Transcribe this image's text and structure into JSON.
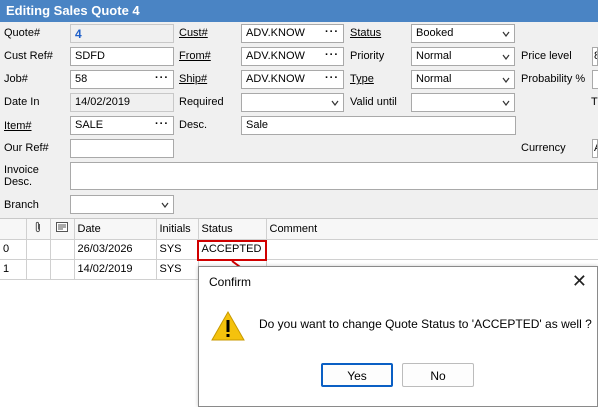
{
  "window": {
    "title": "Editing Sales Quote 4"
  },
  "form": {
    "quote_label": "Quote#",
    "quote_value": "4",
    "cust_label": "Cust#",
    "cust_value": "ADV.KNOW",
    "status_label": "Status",
    "status_value": "Booked",
    "custref_label": "Cust Ref#",
    "custref_value": "SDFD",
    "from_label": "From#",
    "from_value": "ADV.KNOW",
    "priority_label": "Priority",
    "priority_value": "Normal",
    "pricelevel_label": "Price level",
    "pricelevel_value": "8",
    "job_label": "Job#",
    "job_value": "58",
    "ship_label": "Ship#",
    "ship_value": "ADV.KNOW",
    "type_label": "Type",
    "type_value": "Normal",
    "probability_label": "Probability %",
    "probability_value": "",
    "datein_label": "Date In",
    "datein_value": "14/02/2019",
    "required_label": "Required",
    "required_value": "",
    "validuntil_label": "Valid until",
    "validuntil_value": "",
    "item_label": "Item#",
    "item_value": "SALE",
    "desc_label": "Desc.",
    "desc_value": "Sale",
    "ourref_label": "Our Ref#",
    "ourref_value": "",
    "currency_label": "Currency",
    "currency_value": "A",
    "invoice_label": "Invoice Desc.",
    "invoice_value": "",
    "branch_label": "Branch",
    "branch_value": "",
    "edge_t": "T"
  },
  "grid": {
    "columns": [
      "",
      "",
      "",
      "Date",
      "Initials",
      "Status",
      "Comment"
    ],
    "rows": [
      {
        "index": "0",
        "date": "26/03/2026",
        "initials": "SYS",
        "status": "ACCEPTED",
        "comment": ""
      },
      {
        "index": "1",
        "date": "14/02/2019",
        "initials": "SYS",
        "status": "",
        "comment": ""
      }
    ]
  },
  "dialog": {
    "title": "Confirm",
    "message": "Do you want to change Quote Status to 'ACCEPTED' as well ?",
    "yes_label": "Yes",
    "no_label": "No"
  },
  "colors": {
    "title_bar": "#4a84c4",
    "highlight": "#d00000",
    "primary_button_border": "#0a5fc4"
  }
}
